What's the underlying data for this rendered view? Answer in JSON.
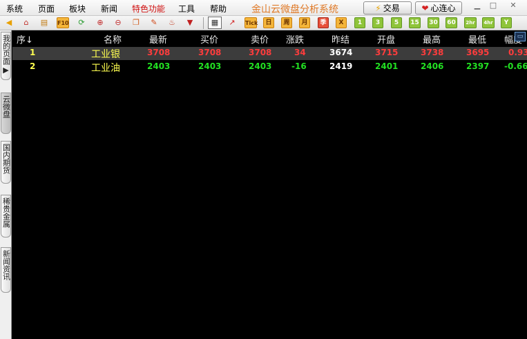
{
  "menu": [
    "系统",
    "页面",
    "板块",
    "新闻",
    "特色功能",
    "工具",
    "帮助"
  ],
  "app_title": "金山云微盘分析系统",
  "buttons": {
    "trade": "交易",
    "heart": "心连心"
  },
  "toolbar": {
    "periods": [
      "Tick",
      "日",
      "周",
      "月",
      "季",
      "X",
      "1",
      "3",
      "5",
      "15",
      "30",
      "60",
      "2hr",
      "4hr",
      "Y"
    ]
  },
  "side_tabs": [
    "我的页面",
    "云微盘",
    "国内期货",
    "稀贵金属",
    "新闻资讯"
  ],
  "table": {
    "headers": [
      "序↓",
      "名称",
      "最新",
      "买价",
      "卖价",
      "涨跌",
      "昨结",
      "开盘",
      "最高",
      "最低",
      "幅度"
    ],
    "rows": [
      {
        "seq": "1",
        "name": "工业银",
        "last": "3708",
        "bid": "3708",
        "ask": "3708",
        "change": "34",
        "prev_settle": "3674",
        "open": "3715",
        "high": "3738",
        "low": "3695",
        "pct": "0.93"
      },
      {
        "seq": "2",
        "name": "工业油",
        "last": "2403",
        "bid": "2403",
        "ask": "2403",
        "change": "-16",
        "prev_settle": "2419",
        "open": "2401",
        "high": "2406",
        "low": "2397",
        "pct": "-0.66"
      }
    ]
  },
  "colors": {
    "up": "#ff3c3c",
    "down": "#22e022",
    "name": "#ffff50",
    "neutral": "#ffffff",
    "title": "#e07a28"
  }
}
